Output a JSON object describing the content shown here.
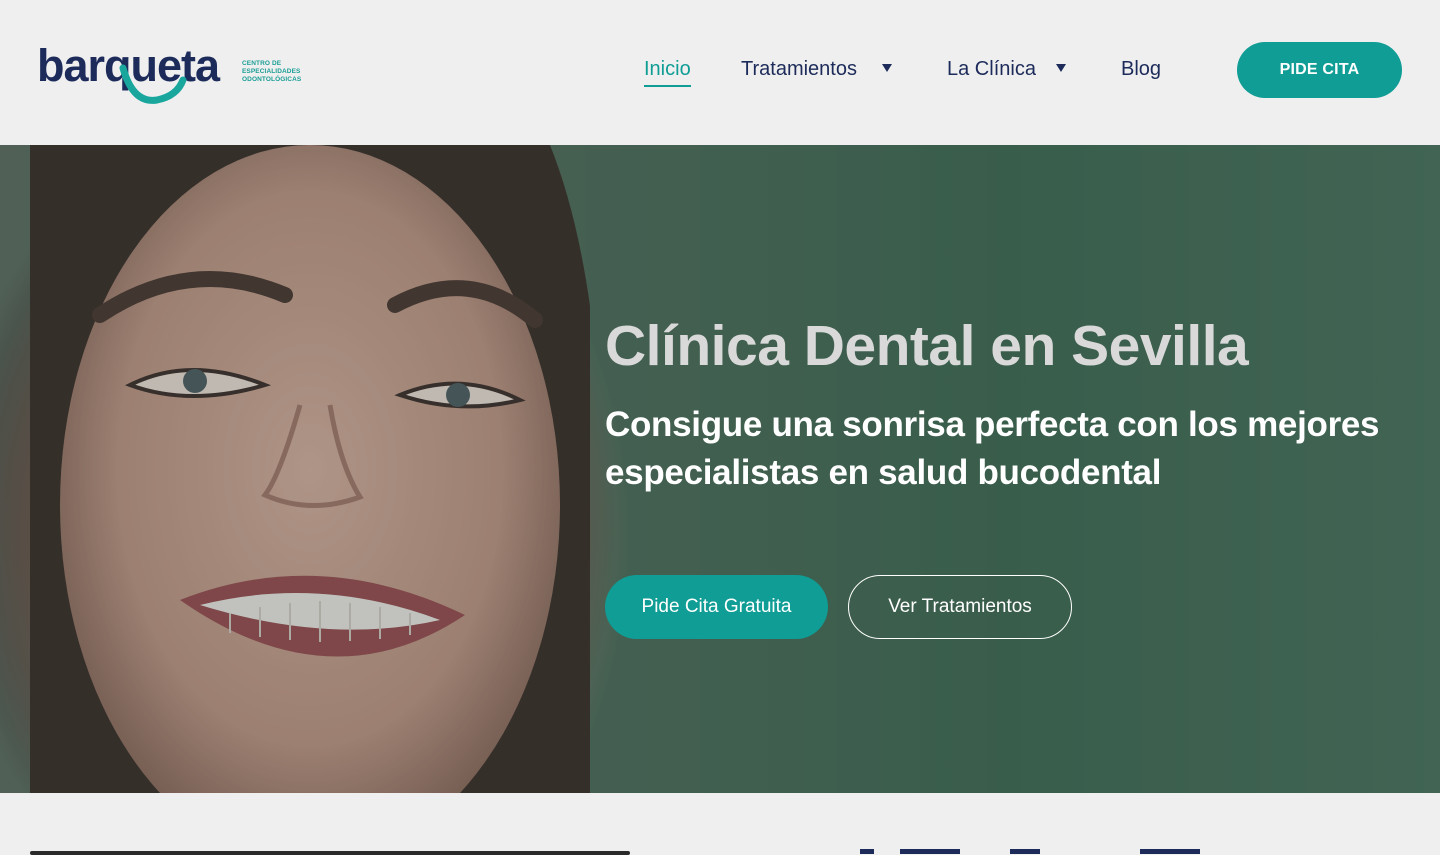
{
  "brand": {
    "name": "barqueta",
    "subtitle_lines": [
      "CENTRO DE",
      "ESPECIALIDADES",
      "ODONTOLÓGICAS"
    ],
    "color_primary": "#1c2b5a",
    "color_accent": "#0f9d95"
  },
  "nav": {
    "items": [
      {
        "label": "Inicio",
        "active": true
      },
      {
        "label": "Tratamientos",
        "has_dropdown": true
      },
      {
        "label": "La Clínica",
        "has_dropdown": true
      },
      {
        "label": "Blog"
      }
    ],
    "cta_label": "PIDE CITA"
  },
  "hero": {
    "title": "Clínica Dental en Sevilla",
    "subtitle": "Consigue una sonrisa perfecta con los mejores especialistas en salud bucodental",
    "primary_button": "Pide Cita Gratuita",
    "secondary_button": "Ver Tratamientos"
  }
}
